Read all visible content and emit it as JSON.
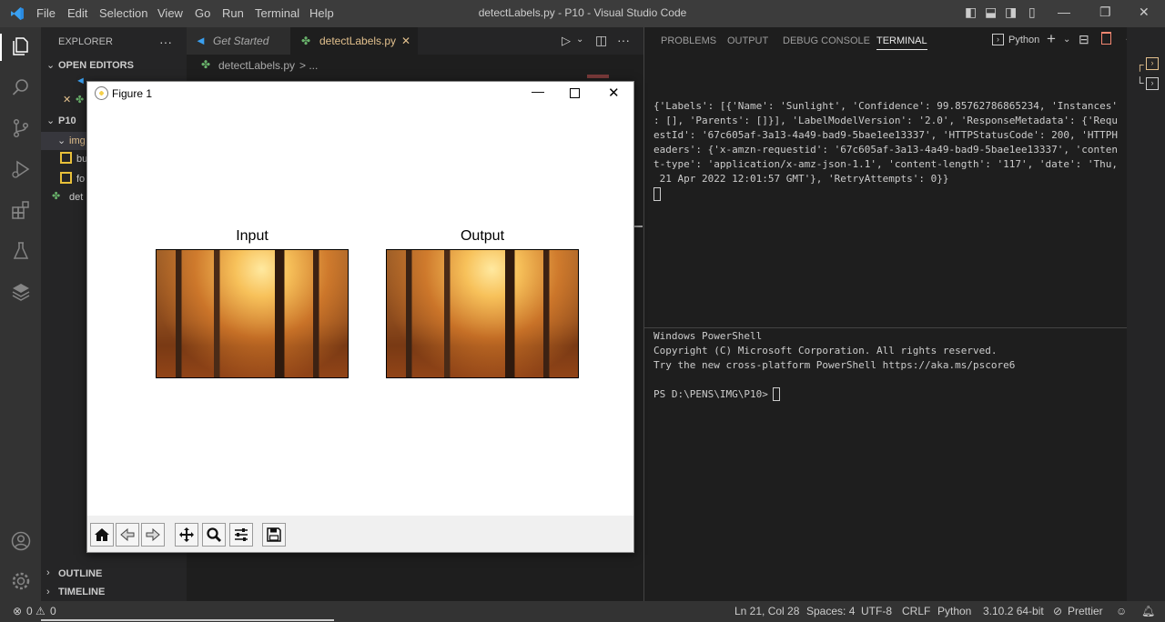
{
  "titlebar": {
    "menu": [
      "File",
      "Edit",
      "Selection",
      "View",
      "Go",
      "Run",
      "Terminal",
      "Help"
    ],
    "window_title": "detectLabels.py - P10 - Visual Studio Code"
  },
  "sidebar": {
    "header": "EXPLORER",
    "more": "···",
    "open_editors": "OPEN EDITORS",
    "folder": "P10",
    "items": [
      "img",
      "bu",
      "fo",
      "det"
    ],
    "outline": "OUTLINE",
    "timeline": "TIMELINE"
  },
  "tabs": [
    {
      "label": "Get Started"
    },
    {
      "label": "detectLabels.py"
    }
  ],
  "breadcrumb": {
    "file": "detectLabels.py",
    "rest": "> ..."
  },
  "panel": {
    "tabs": [
      "PROBLEMS",
      "OUTPUT",
      "DEBUG CONSOLE",
      "TERMINAL"
    ],
    "terminal_name": "Python",
    "output_lines": [
      "{'Labels': [{'Name': 'Sunlight', 'Confidence': 99.85762786865234, 'Instances'",
      ": [], 'Parents': []}], 'LabelModelVersion': '2.0', 'ResponseMetadata': {'Requ",
      "estId': '67c605af-3a13-4a49-bad9-5bae1ee13337', 'HTTPStatusCode': 200, 'HTTPH",
      "eaders': {'x-amzn-requestid': '67c605af-3a13-4a49-bad9-5bae1ee13337', 'conten",
      "t-type': 'application/x-amz-json-1.1', 'content-length': '117', 'date': 'Thu,",
      " 21 Apr 2022 12:01:57 GMT'}, 'RetryAttempts': 0}}"
    ],
    "ps_lines": [
      "Windows PowerShell",
      "Copyright (C) Microsoft Corporation. All rights reserved.",
      "Try the new cross-platform PowerShell https://aka.ms/pscore6",
      "",
      "PS D:\\PENS\\IMG\\P10> "
    ]
  },
  "status": {
    "errors": "0",
    "warnings": "0",
    "position": "Ln 21, Col 28",
    "spaces": "Spaces: 4",
    "encoding": "UTF-8",
    "eol": "CRLF",
    "language": "Python",
    "interpreter": "3.10.2 64-bit",
    "prettier": "Prettier"
  },
  "figure": {
    "title": "Figure 1",
    "axes": [
      {
        "title": "Input"
      },
      {
        "title": "Output"
      }
    ]
  },
  "colors": {
    "accent": "#0078d4",
    "tab_active_text": "#e2c08d",
    "terminal_tab_underline": "#e7e7e7"
  }
}
